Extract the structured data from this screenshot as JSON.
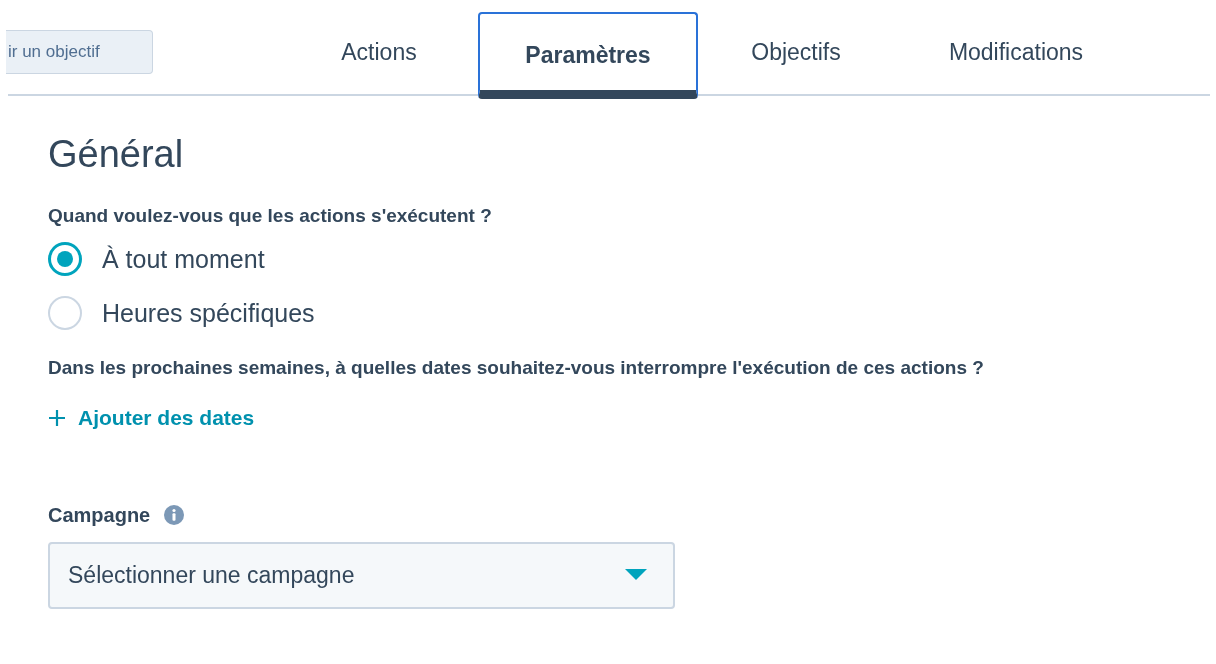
{
  "goal_button": {
    "label": "ir un objectif"
  },
  "tabs": [
    {
      "label": "Actions",
      "selected": false
    },
    {
      "label": "Paramètres",
      "selected": true
    },
    {
      "label": "Objectifs",
      "selected": false
    },
    {
      "label": "Modifications",
      "selected": false
    }
  ],
  "section": {
    "title": "Général"
  },
  "run_time": {
    "question": "Quand voulez-vous que les actions s'exécutent ?",
    "options": [
      {
        "label": "À tout moment",
        "selected": true
      },
      {
        "label": "Heures spécifiques",
        "selected": false
      }
    ]
  },
  "pause_dates": {
    "question": "Dans les prochaines semaines, à quelles dates souhaitez-vous interrompre l'exécution de ces actions ?",
    "add_link": "Ajouter des dates"
  },
  "campaign": {
    "label": "Campagne",
    "placeholder": "Sélectionner une campagne"
  }
}
